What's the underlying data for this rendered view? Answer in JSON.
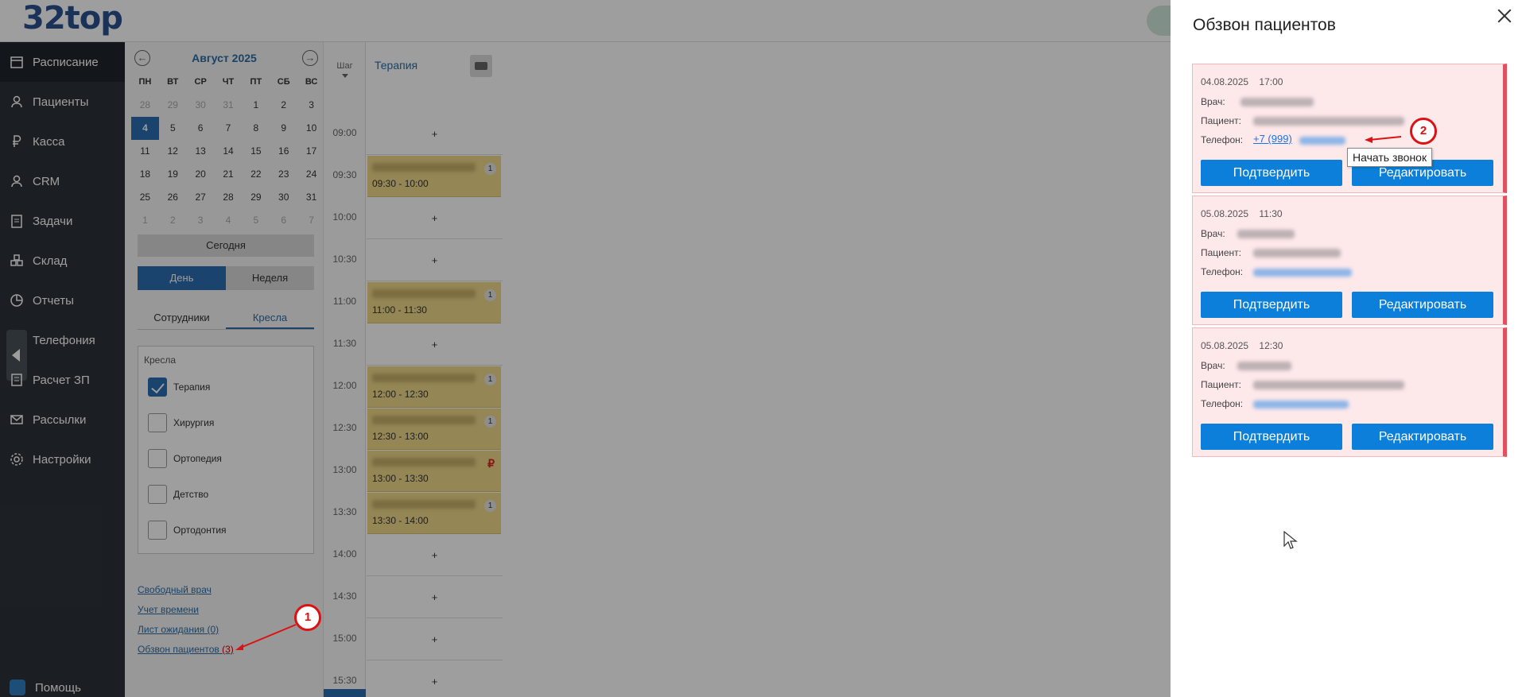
{
  "app": {
    "logo": "32top"
  },
  "sidebar": {
    "items": [
      {
        "label": "Расписание",
        "icon": "calendar-icon",
        "active": true
      },
      {
        "label": "Пациенты",
        "icon": "user-icon"
      },
      {
        "label": "Касса",
        "icon": "ruble-icon"
      },
      {
        "label": "CRM",
        "icon": "person-icon"
      },
      {
        "label": "Задачи",
        "icon": "clipboard-icon"
      },
      {
        "label": "Склад",
        "icon": "boxes-icon"
      },
      {
        "label": "Отчеты",
        "icon": "pie-chart-icon"
      },
      {
        "label": "Телефония",
        "icon": "phone-icon"
      },
      {
        "label": "Расчет ЗП",
        "icon": "calculator-icon"
      },
      {
        "label": "Рассылки",
        "icon": "mail-icon"
      },
      {
        "label": "Настройки",
        "icon": "gear-icon"
      }
    ],
    "help": "Помощь"
  },
  "calendar": {
    "title": "Август 2025",
    "dow": [
      "ПН",
      "ВТ",
      "СР",
      "ЧТ",
      "ПТ",
      "СБ",
      "ВС"
    ],
    "weeks": [
      [
        "28",
        "29",
        "30",
        "31",
        "1",
        "2",
        "3"
      ],
      [
        "4",
        "5",
        "6",
        "7",
        "8",
        "9",
        "10"
      ],
      [
        "11",
        "12",
        "13",
        "14",
        "15",
        "16",
        "17"
      ],
      [
        "18",
        "19",
        "20",
        "21",
        "22",
        "23",
        "24"
      ],
      [
        "25",
        "26",
        "27",
        "28",
        "29",
        "30",
        "31"
      ],
      [
        "1",
        "2",
        "3",
        "4",
        "5",
        "6",
        "7"
      ]
    ],
    "today_btn": "Сегодня",
    "view_day": "День",
    "view_week": "Неделя"
  },
  "filters": {
    "tab_staff": "Сотрудники",
    "tab_chairs": "Кресла",
    "chairs_title": "Кресла",
    "chairs": [
      {
        "label": "Терапия",
        "checked": true
      },
      {
        "label": "Хирургия",
        "checked": false
      },
      {
        "label": "Ортопедия",
        "checked": false
      },
      {
        "label": "Детство",
        "checked": false
      },
      {
        "label": "Ортодонтия",
        "checked": false
      }
    ]
  },
  "links": {
    "free_doctor": "Свободный врач",
    "time_tracking": "Учет времени",
    "waitlist": "Лист ожидания (0)",
    "callout": "Обзвон пациентов",
    "callout_count": "(3)"
  },
  "schedule": {
    "step_label": "Шаг",
    "room": "Терапия",
    "slots": [
      {
        "time": "09:00",
        "plus": "+"
      },
      {
        "time": "09:30",
        "appt": "09:30 - 10:00",
        "badge": "1"
      },
      {
        "time": "10:00",
        "plus": "+"
      },
      {
        "time": "10:30",
        "plus": "+"
      },
      {
        "time": "11:00",
        "appt": "11:00 - 11:30",
        "badge": "1"
      },
      {
        "time": "11:30",
        "plus": "+"
      },
      {
        "time": "12:00",
        "appt": "12:00 - 12:30",
        "badge": "1"
      },
      {
        "time": "12:30",
        "appt": "12:30 - 13:00",
        "badge": "1"
      },
      {
        "time": "13:00",
        "appt": "13:00 - 13:30",
        "badge": "₽"
      },
      {
        "time": "13:30",
        "appt": "13:30 - 14:00",
        "badge": "1"
      },
      {
        "time": "14:00",
        "plus": "+"
      },
      {
        "time": "14:30",
        "plus": "+"
      },
      {
        "time": "15:00",
        "plus": "+"
      },
      {
        "time": "15:30",
        "plus": "+"
      }
    ]
  },
  "drawer": {
    "title": "Обзвон пациентов",
    "labels": {
      "doctor": "Врач:",
      "patient": "Пациент:",
      "phone": "Телефон:"
    },
    "confirm": "Подтвердить",
    "edit": "Редактировать",
    "cards": [
      {
        "date": "04.08.2025",
        "time": "17:00",
        "phone": "+7 (999)"
      },
      {
        "date": "05.08.2025",
        "time": "11:30",
        "phone": ""
      },
      {
        "date": "05.08.2025",
        "time": "12:30",
        "phone": ""
      }
    ],
    "tooltip": "Начать звонок"
  },
  "markers": {
    "one": "1",
    "two": "2"
  },
  "colors": {
    "accent": "#0b7fd9",
    "card_bg": "#fde8ea",
    "card_edge": "#e0505f",
    "marker": "#d11111"
  }
}
